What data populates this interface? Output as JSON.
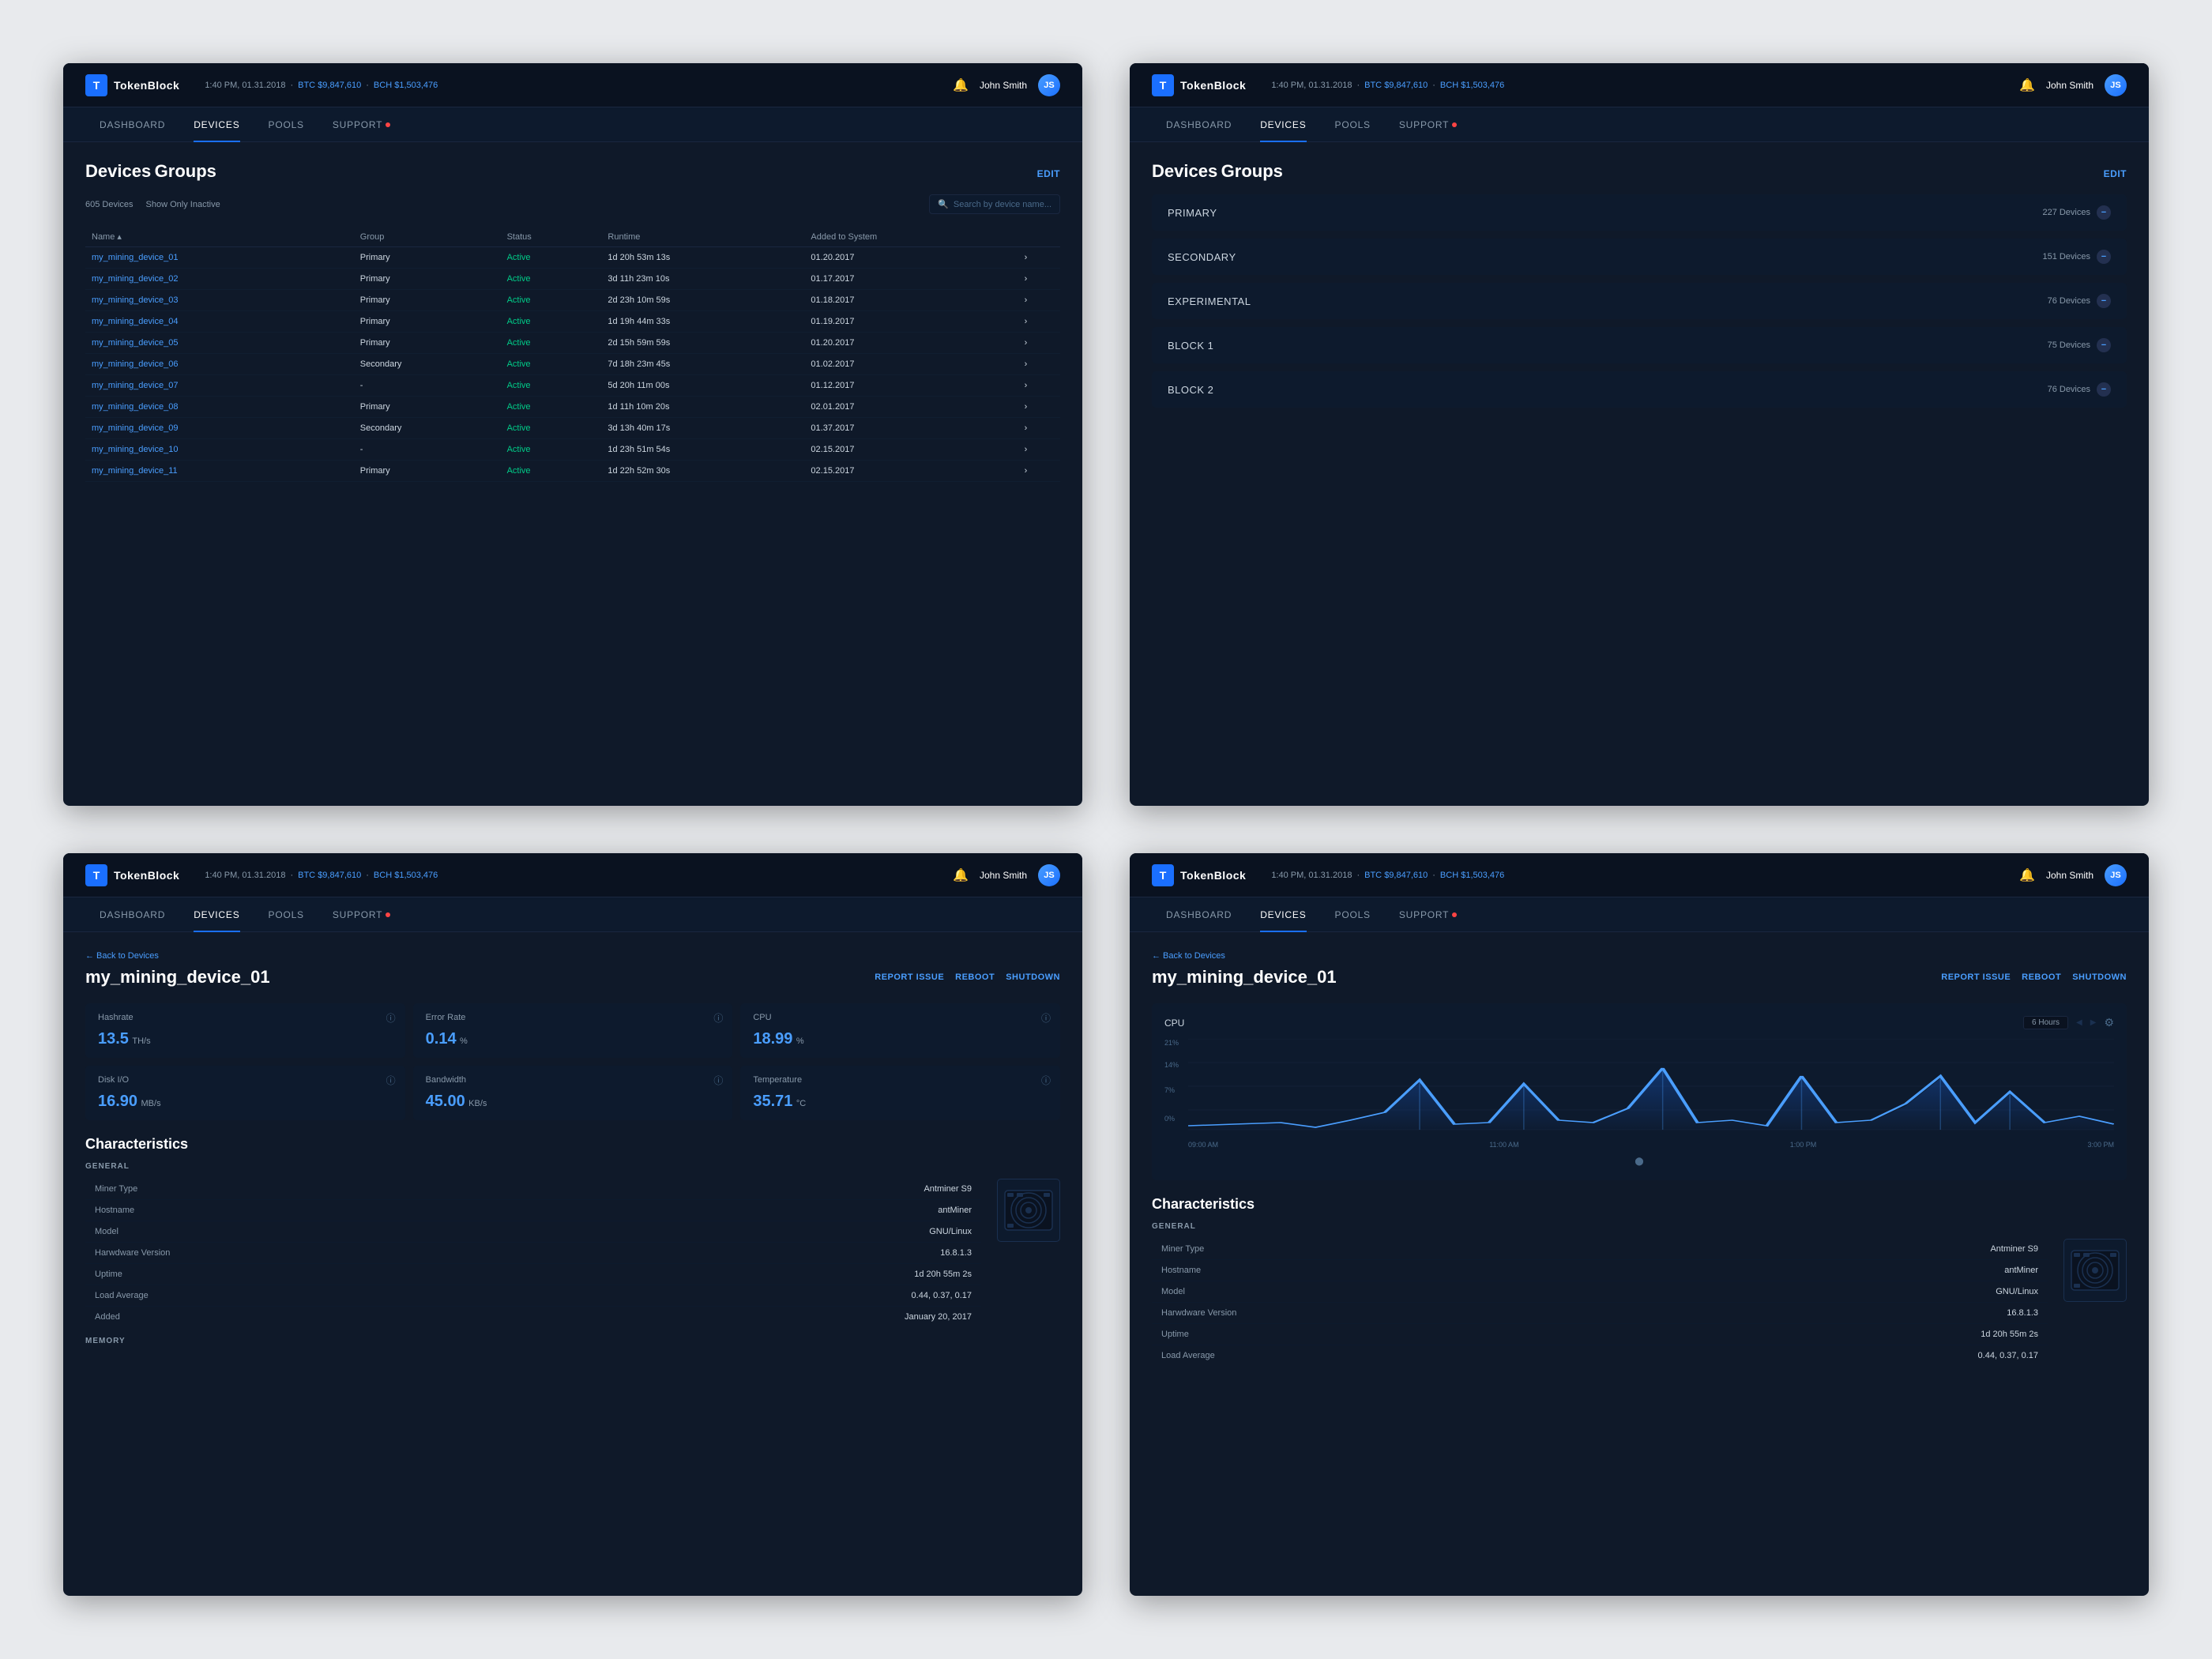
{
  "app": {
    "logo": "T",
    "name": "TokenBlock"
  },
  "header": {
    "time": "1:40 PM, 01.31.2018",
    "btc_label": "BTC",
    "btc_value": "$9,847,610",
    "bch_label": "BCH",
    "bch_value": "$1,503,476",
    "user": "John Smith",
    "user_initials": "JS"
  },
  "nav": {
    "items": [
      "DASHBOARD",
      "DEVICES",
      "POOLS",
      "SUPPORT"
    ]
  },
  "panel1": {
    "title": "Devices",
    "groups_link": "Groups",
    "edit_label": "EDIT",
    "count": "605 Devices",
    "show_inactive": "Show Only Inactive",
    "search_placeholder": "Search by device name...",
    "table_headers": [
      "Name",
      "Group",
      "Status",
      "Runtime",
      "Added to System"
    ],
    "devices": [
      {
        "name": "my_mining_device_01",
        "group": "Primary",
        "status": "Active",
        "runtime": "1d 20h 53m 13s",
        "added": "01.20.2017"
      },
      {
        "name": "my_mining_device_02",
        "group": "Primary",
        "status": "Active",
        "runtime": "3d 11h 23m 10s",
        "added": "01.17.2017"
      },
      {
        "name": "my_mining_device_03",
        "group": "Primary",
        "status": "Active",
        "runtime": "2d 23h 10m 59s",
        "added": "01.18.2017"
      },
      {
        "name": "my_mining_device_04",
        "group": "Primary",
        "status": "Active",
        "runtime": "1d 19h 44m 33s",
        "added": "01.19.2017"
      },
      {
        "name": "my_mining_device_05",
        "group": "Primary",
        "status": "Active",
        "runtime": "2d 15h 59m 59s",
        "added": "01.20.2017"
      },
      {
        "name": "my_mining_device_06",
        "group": "Secondary",
        "status": "Active",
        "runtime": "7d 18h 23m 45s",
        "added": "01.02.2017"
      },
      {
        "name": "my_mining_device_07",
        "group": "-",
        "status": "Active",
        "runtime": "5d 20h 11m 00s",
        "added": "01.12.2017"
      },
      {
        "name": "my_mining_device_08",
        "group": "Primary",
        "status": "Active",
        "runtime": "1d 11h 10m 20s",
        "added": "02.01.2017"
      },
      {
        "name": "my_mining_device_09",
        "group": "Secondary",
        "status": "Active",
        "runtime": "3d 13h 40m 17s",
        "added": "01.37.2017"
      },
      {
        "name": "my_mining_device_10",
        "group": "-",
        "status": "Active",
        "runtime": "1d 23h 51m 54s",
        "added": "02.15.2017"
      },
      {
        "name": "my_mining_device_11",
        "group": "Primary",
        "status": "Active",
        "runtime": "1d 22h 52m 30s",
        "added": "02.15.2017"
      }
    ]
  },
  "panel2": {
    "title": "Devices",
    "groups_link": "Groups",
    "edit_label": "EDIT",
    "groups": [
      {
        "name": "PRIMARY",
        "count": "227 Devices",
        "has_add": true
      },
      {
        "name": "SECONDARY",
        "count": "151 Devices",
        "has_add": true
      },
      {
        "name": "EXPERIMENTAL",
        "count": "76 Devices",
        "has_add": true
      },
      {
        "name": "BLOCK 1",
        "count": "75 Devices",
        "has_add": true
      },
      {
        "name": "BLOCK 2",
        "count": "76 Devices",
        "has_add": true
      }
    ]
  },
  "panel3": {
    "back_label": "← Back to Devices",
    "device_name": "my_mining_device_01",
    "actions": [
      "REPORT ISSUE",
      "REBOOT",
      "SHUTDOWN"
    ],
    "metrics": [
      {
        "label": "Hashrate",
        "value": "13.5",
        "unit": "TH/s"
      },
      {
        "label": "Error Rate",
        "value": "0.14",
        "unit": "%"
      },
      {
        "label": "CPU",
        "value": "18.99",
        "unit": "%"
      },
      {
        "label": "Disk I/O",
        "value": "16.90",
        "unit": "MB/s"
      },
      {
        "label": "Bandwidth",
        "value": "45.00",
        "unit": "KB/s"
      },
      {
        "label": "Temperature",
        "value": "35.71",
        "unit": "°C"
      }
    ],
    "characteristics_title": "Characteristics",
    "general_label": "GENERAL",
    "char_rows": [
      {
        "label": "Miner Type",
        "value": "Antminer S9"
      },
      {
        "label": "Hostname",
        "value": "antMiner"
      },
      {
        "label": "Model",
        "value": "GNU/Linux"
      },
      {
        "label": "Harwdware Version",
        "value": "16.8.1.3"
      },
      {
        "label": "Uptime",
        "value": "1d 20h 55m 2s"
      },
      {
        "label": "Load Average",
        "value": "0.44, 0.37, 0.17"
      },
      {
        "label": "Added",
        "value": "January 20, 2017"
      }
    ],
    "memory_label": "MEMORY"
  },
  "panel4": {
    "back_label": "← Back to Devices",
    "device_name": "my_mining_device_01",
    "actions": [
      "REPORT ISSUE",
      "REBOOT",
      "SHUTDOWN"
    ],
    "chart_title": "CPU",
    "chart_hours": "6 Hours",
    "chart_y_labels": [
      "21%",
      "14%",
      "7%",
      "0%"
    ],
    "chart_x_labels": [
      "09:00 AM",
      "11:00 AM",
      "1:00 PM",
      "3:00 PM"
    ],
    "characteristics_title": "Characteristics",
    "general_label": "GENERAL",
    "char_rows": [
      {
        "label": "Miner Type",
        "value": "Antminer S9"
      },
      {
        "label": "Hostname",
        "value": "antMiner"
      },
      {
        "label": "Model",
        "value": "GNU/Linux"
      },
      {
        "label": "Harwdware Version",
        "value": "16.8.1.3"
      },
      {
        "label": "Uptime",
        "value": "1d 20h 55m 2s"
      },
      {
        "label": "Load Average",
        "value": "0.44, 0.37, 0.17"
      }
    ]
  }
}
